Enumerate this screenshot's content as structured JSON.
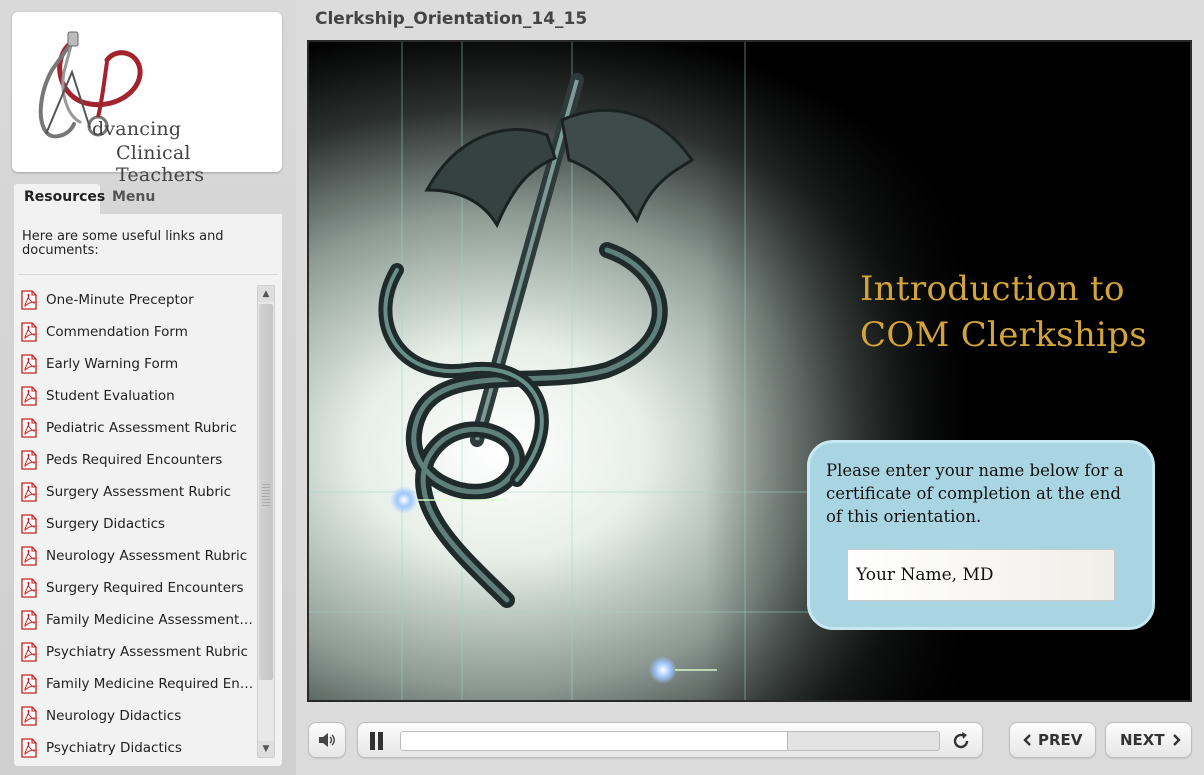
{
  "logo": {
    "line1": "dvancing",
    "line2": "Clinical Teachers"
  },
  "tabs": [
    {
      "label": "Resources",
      "active": true
    },
    {
      "label": "Menu",
      "active": false
    }
  ],
  "resources": {
    "intro": "Here are some useful links and documents:",
    "items": [
      {
        "label": "One-Minute Preceptor",
        "icon": "pdf-icon"
      },
      {
        "label": "Commendation Form",
        "icon": "pdf-icon"
      },
      {
        "label": "Early Warning Form",
        "icon": "pdf-icon"
      },
      {
        "label": "Student Evaluation",
        "icon": "pdf-icon"
      },
      {
        "label": "Pediatric Assessment Rubric",
        "icon": "pdf-icon"
      },
      {
        "label": "Peds Required Encounters",
        "icon": "pdf-icon"
      },
      {
        "label": "Surgery Assessment Rubric",
        "icon": "pdf-icon"
      },
      {
        "label": "Surgery Didactics",
        "icon": "pdf-icon"
      },
      {
        "label": "Neurology Assessment Rubric",
        "icon": "pdf-icon"
      },
      {
        "label": "Surgery Required Encounters",
        "icon": "pdf-icon"
      },
      {
        "label": "Family Medicine Assessment ...",
        "icon": "pdf-icon"
      },
      {
        "label": "Psychiatry Assessment Rubric",
        "icon": "pdf-icon"
      },
      {
        "label": "Family Medicine Required Enc...",
        "icon": "pdf-icon"
      },
      {
        "label": "Neurology Didactics",
        "icon": "pdf-icon"
      },
      {
        "label": "Psychiatry Didactics",
        "icon": "pdf-icon"
      }
    ]
  },
  "player": {
    "title": "Clerkship_Orientation_14_15",
    "progress_fraction": 0.72
  },
  "slide": {
    "heading_line1": "Introduction to",
    "heading_line2": "COM Clerkships",
    "prompt": "Please enter your name below for a certificate of completion at the end of this orientation.",
    "name_value": "Your Name, MD"
  },
  "controls": {
    "prev_label": "PREV",
    "next_label": "NEXT"
  },
  "colors": {
    "heading": "#d4a438",
    "name_box": "#a9d5e3",
    "logo_accent": "#a3242e"
  }
}
